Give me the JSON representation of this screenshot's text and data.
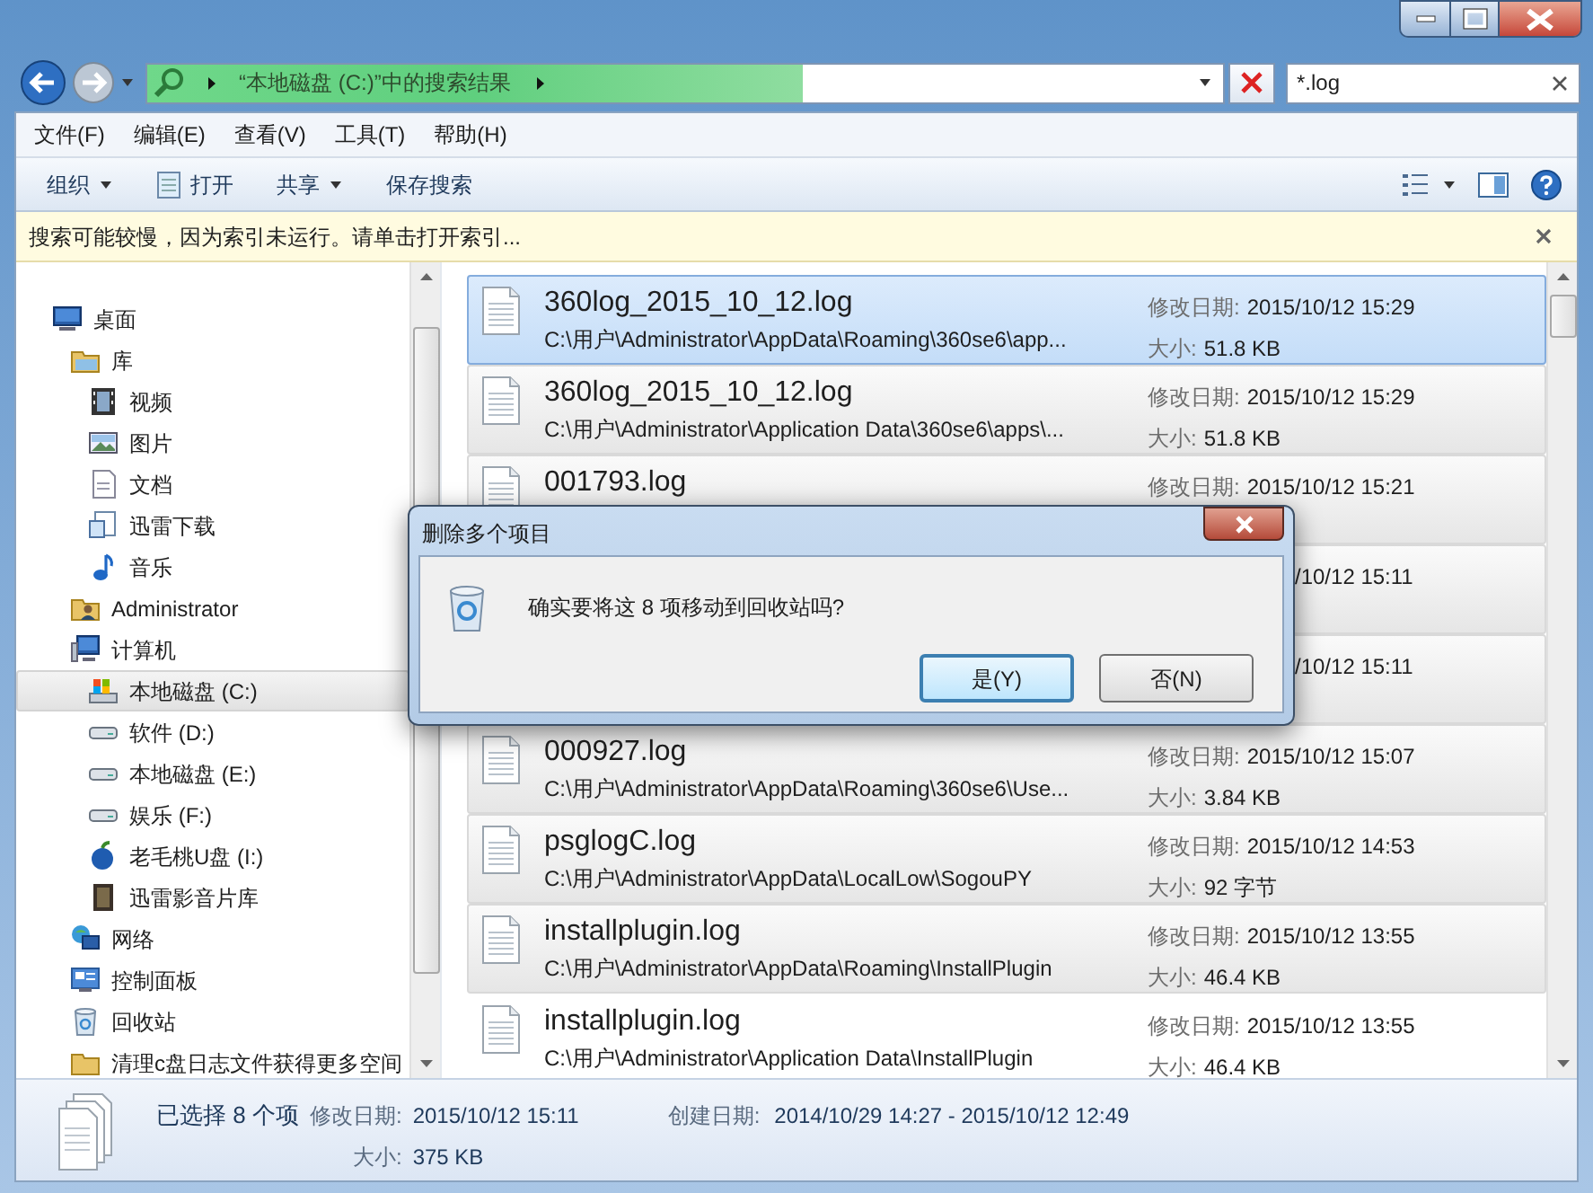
{
  "address_bar": {
    "location": "“本地磁盘 (C:)”中的搜索结果",
    "level": 0.61
  },
  "search": {
    "value": "*.log"
  },
  "menu": [
    "文件(F)",
    "编辑(E)",
    "查看(V)",
    "工具(T)",
    "帮助(H)"
  ],
  "toolbar": [
    {
      "label": "组织",
      "kind": "dropdown"
    },
    {
      "label": "打开",
      "kind": "icon"
    },
    {
      "label": "共享",
      "kind": "dropdown"
    },
    {
      "label": "保存搜索",
      "kind": "plain"
    }
  ],
  "info_bar": "搜索可能较慢，因为索引未运行。请单击打开索引...",
  "sidebar": {
    "items": [
      {
        "label": "桌面",
        "selected": false,
        "children": [
          {
            "label": "库",
            "selected": false,
            "children": [
              {
                "label": "视频",
                "selected": false
              },
              {
                "label": "图片",
                "selected": false
              },
              {
                "label": "文档",
                "selected": false
              },
              {
                "label": "迅雷下载",
                "selected": false
              },
              {
                "label": "音乐",
                "selected": false
              }
            ]
          },
          {
            "label": "Administrator",
            "selected": false
          },
          {
            "label": "计算机",
            "selected": false,
            "children": [
              {
                "label": "本地磁盘 (C:)",
                "selected": true
              },
              {
                "label": "软件 (D:)",
                "selected": false
              },
              {
                "label": "本地磁盘 (E:)",
                "selected": false
              },
              {
                "label": "娱乐 (F:)",
                "selected": false
              },
              {
                "label": "老毛桃U盘 (I:)",
                "selected": false
              },
              {
                "label": "迅雷影音片库",
                "selected": false
              }
            ]
          },
          {
            "label": "网络",
            "selected": false
          },
          {
            "label": "控制面板",
            "selected": false
          },
          {
            "label": "回收站",
            "selected": false
          },
          {
            "label": "清理c盘日志文件获得更多空间",
            "selected": false
          }
        ]
      }
    ]
  },
  "results": [
    {
      "kind": "full",
      "name": "360log_2015_10_12.log",
      "path": "C:\\用户\\Administrator\\AppData\\Roaming\\360se6\\app...",
      "date_label": "修改日期:",
      "date": "2015/10/12 15:29",
      "size_label": "大小:",
      "size": "51.8 KB",
      "selected": true,
      "focused": true
    },
    {
      "kind": "full",
      "name": "360log_2015_10_12.log",
      "path": "C:\\用户\\Administrator\\Application Data\\360se6\\apps\\...",
      "date_label": "修改日期:",
      "date": "2015/10/12 15:29",
      "size_label": "大小:",
      "size": "51.8 KB",
      "selected": true,
      "focused": false
    },
    {
      "kind": "full",
      "name": "001793.log",
      "date_label": "修改日期:",
      "date": "2015/10/12 15:21",
      "selected": true,
      "focused": false
    },
    {
      "kind": "partial",
      "date_fragment": "/10/12 15:11",
      "selected": true,
      "focused": false
    },
    {
      "kind": "partial",
      "date_fragment": "/10/12 15:11",
      "selected": true,
      "focused": false
    },
    {
      "kind": "full",
      "name": "000927.log",
      "path": "C:\\用户\\Administrator\\AppData\\Roaming\\360se6\\Use...",
      "date_label": "修改日期:",
      "date": "2015/10/12 15:07",
      "size_label": "大小:",
      "size": "3.84 KB",
      "selected": true,
      "focused": false
    },
    {
      "kind": "full",
      "name": "psglogC.log",
      "path": "C:\\用户\\Administrator\\AppData\\LocalLow\\SogouPY",
      "date_label": "修改日期:",
      "date": "2015/10/12 14:53",
      "size_label": "大小:",
      "size": "92 字节",
      "selected": true,
      "focused": false
    },
    {
      "kind": "full",
      "name": "installplugin.log",
      "path": "C:\\用户\\Administrator\\AppData\\Roaming\\InstallPlugin",
      "date_label": "修改日期:",
      "date": "2015/10/12 13:55",
      "size_label": "大小:",
      "size": "46.4 KB",
      "selected": true,
      "focused": false
    },
    {
      "kind": "full",
      "name": "installplugin.log",
      "path": "C:\\用户\\Administrator\\Application Data\\InstallPlugin",
      "date_label": "修改日期:",
      "date": "2015/10/12 13:55",
      "size_label": "大小:",
      "size": "46.4 KB",
      "selected": false,
      "focused": false
    }
  ],
  "details": {
    "selection": "已选择 8 个项",
    "modified_label": "修改日期:",
    "modified": "2015/10/12 15:11",
    "created_label": "创建日期:",
    "created": "2014/10/29 14:27 - 2015/10/12 12:49",
    "size_label": "大小:",
    "size": "375 KB"
  },
  "dialog": {
    "title": "删除多个项目",
    "message": "确实要将这 8 项移动到回收站吗?",
    "buttons": [
      {
        "label": "是(Y)",
        "focused": true
      },
      {
        "label": "否(N)",
        "focused": false
      }
    ]
  }
}
